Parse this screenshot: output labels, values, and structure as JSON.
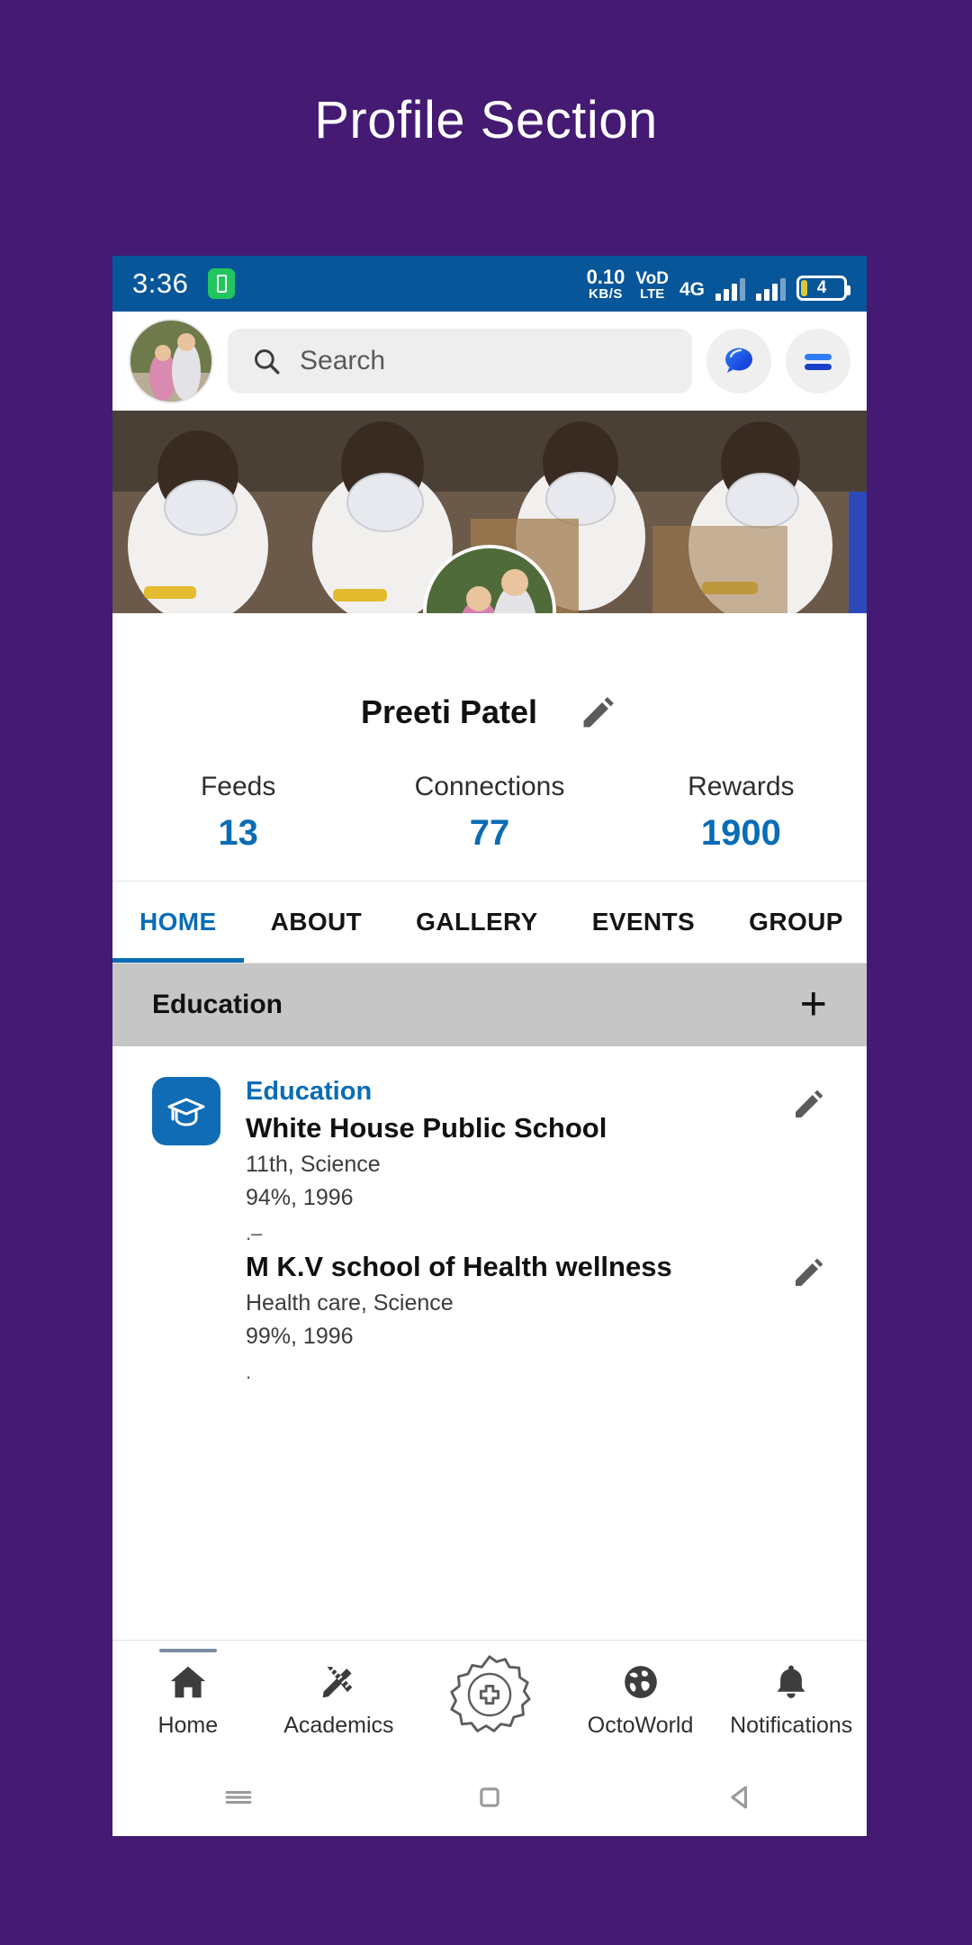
{
  "page": {
    "title": "Profile Section",
    "background": "#441A73"
  },
  "statusbar": {
    "time": "3:36",
    "battery_badge_icon": "battery-charging-icon",
    "network_speed_value": "0.10",
    "network_speed_unit": "KB/S",
    "volte_line1": "VoD",
    "volte_line2": "LTE",
    "network_type": "4G",
    "battery_level": "4",
    "accent": "#075699"
  },
  "appbar": {
    "avatar_icon": "user-avatar",
    "search_placeholder": "Search",
    "search_value": "",
    "search_icon": "search-icon",
    "chat_icon": "chat-bubble-icon",
    "menu_icon": "hamburger-menu-icon"
  },
  "profile": {
    "cover_icon": "cover-photo",
    "avatar_icon": "profile-avatar",
    "name": "Preeti Patel",
    "edit_icon": "pencil-icon",
    "stats": [
      {
        "label": "Feeds",
        "value": "13"
      },
      {
        "label": "Connections",
        "value": "77"
      },
      {
        "label": "Rewards",
        "value": "1900"
      }
    ],
    "stat_color": "#0a6cb5"
  },
  "tabs": [
    {
      "label": "HOME",
      "active": true
    },
    {
      "label": "ABOUT",
      "active": false
    },
    {
      "label": "GALLERY",
      "active": false
    },
    {
      "label": "EVENTS",
      "active": false
    },
    {
      "label": "GROUP",
      "active": false
    }
  ],
  "section": {
    "title": "Education",
    "add_icon": "plus-icon"
  },
  "education": [
    {
      "icon": "graduation-cap-icon",
      "kicker": "Education",
      "title": "White House Public School",
      "line1": "11th, Science",
      "line2": "94%, 1996",
      "trailing": ".–",
      "edit_icon": "pencil-icon"
    },
    {
      "icon": "",
      "kicker": "",
      "title": "M K.V school of Health wellness",
      "line1": "Health care, Science",
      "line2": "99%, 1996",
      "trailing": ".",
      "edit_icon": "pencil-icon"
    }
  ],
  "bottomnav": [
    {
      "label": "Home",
      "icon": "home-icon",
      "active": true
    },
    {
      "label": "Academics",
      "icon": "ruler-pencil-icon",
      "active": false
    },
    {
      "label": "",
      "icon": "add-burst-icon",
      "active": false
    },
    {
      "label": "OctoWorld",
      "icon": "globe-icon",
      "active": false
    },
    {
      "label": "Notifications",
      "icon": "bell-icon",
      "active": false
    }
  ],
  "sysnav": {
    "recents_icon": "recents-icon",
    "home_icon": "home-square-icon",
    "back_icon": "back-triangle-icon"
  }
}
